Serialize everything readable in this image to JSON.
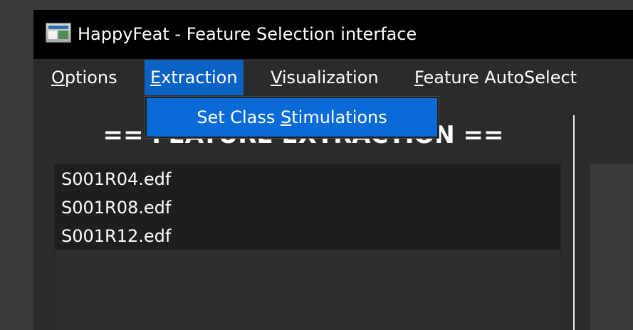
{
  "window": {
    "title": "HappyFeat - Feature Selection interface"
  },
  "menu": {
    "options": {
      "prefix": "",
      "mnemonic": "O",
      "rest": "ptions"
    },
    "extraction": {
      "prefix": "",
      "mnemonic": "E",
      "rest": "xtraction"
    },
    "visualization": {
      "prefix": "",
      "mnemonic": "V",
      "rest": "isualization"
    },
    "feature_autoselect": {
      "prefix": "",
      "mnemonic": "F",
      "rest": "eature AutoSelect"
    }
  },
  "dropdown": {
    "item_prefix": "Set Class ",
    "item_mnemonic": "S",
    "item_rest": "timulations"
  },
  "section_title": "== FEATURE EXTRACTION ==",
  "files": [
    "S001R04.edf",
    "S001R08.edf",
    "S001R12.edf"
  ],
  "colors": {
    "menu_highlight": "#0a63c4",
    "dropdown_highlight": "#0a6bd6"
  }
}
